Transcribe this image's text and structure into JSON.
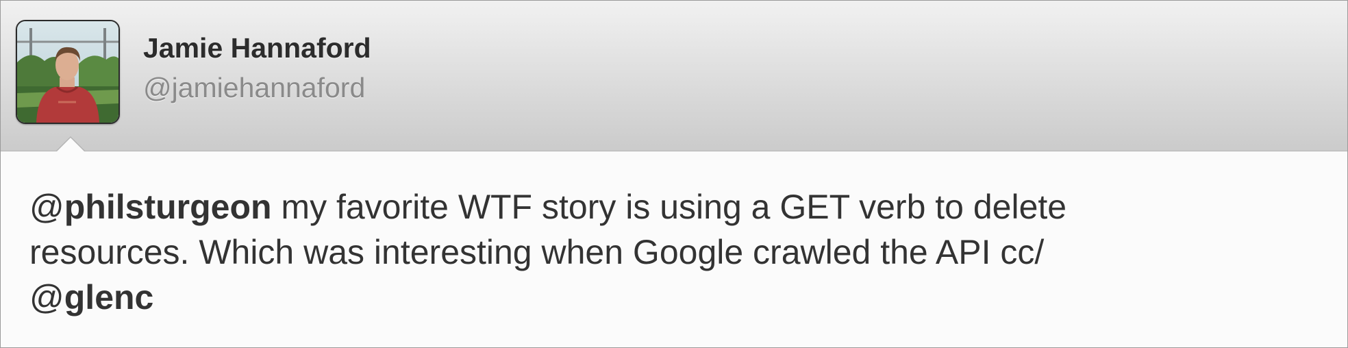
{
  "author": {
    "display_name": "Jamie Hannaford",
    "handle": "@jamiehannaford",
    "avatar_icon": "profile-photo"
  },
  "tweet": {
    "line1": {
      "mention_at": "@",
      "mention_name": "philsturgeon",
      "text": " my favorite WTF story is using a GET verb to delete"
    },
    "line2": {
      "text": "resources. Which was interesting when Google crawled the API cc/"
    },
    "line3": {
      "mention_at": "@",
      "mention_name": "glenc"
    }
  },
  "colors": {
    "header_top": "#f1f1f1",
    "header_bottom": "#cbcbcb",
    "body_background": "#fbfbfb",
    "text": "#333333",
    "handle_text": "#8a8a8a"
  }
}
